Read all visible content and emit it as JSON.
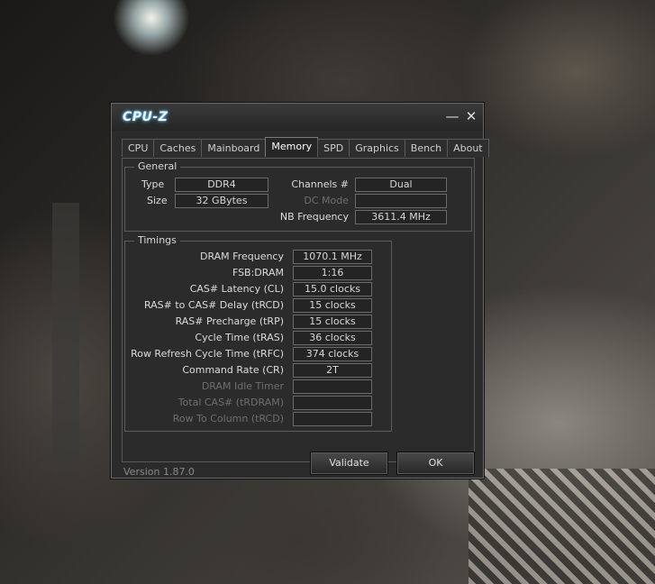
{
  "window": {
    "title": "CPU-Z",
    "minimize_glyph": "—",
    "close_glyph": "✕"
  },
  "tabs": [
    {
      "label": "CPU"
    },
    {
      "label": "Caches"
    },
    {
      "label": "Mainboard"
    },
    {
      "label": "Memory",
      "active": true
    },
    {
      "label": "SPD"
    },
    {
      "label": "Graphics"
    },
    {
      "label": "Bench"
    },
    {
      "label": "About"
    }
  ],
  "general": {
    "title": "General",
    "type_label": "Type",
    "type_value": "DDR4",
    "size_label": "Size",
    "size_value": "32 GBytes",
    "channels_label": "Channels #",
    "channels_value": "Dual",
    "dcmode_label": "DC Mode",
    "dcmode_value": "",
    "nbfreq_label": "NB Frequency",
    "nbfreq_value": "3611.4 MHz"
  },
  "timings": {
    "title": "Timings",
    "rows": [
      {
        "label": "DRAM Frequency",
        "value": "1070.1 MHz",
        "enabled": true
      },
      {
        "label": "FSB:DRAM",
        "value": "1:16",
        "enabled": true
      },
      {
        "label": "CAS# Latency (CL)",
        "value": "15.0 clocks",
        "enabled": true
      },
      {
        "label": "RAS# to CAS# Delay (tRCD)",
        "value": "15 clocks",
        "enabled": true
      },
      {
        "label": "RAS# Precharge (tRP)",
        "value": "15 clocks",
        "enabled": true
      },
      {
        "label": "Cycle Time (tRAS)",
        "value": "36 clocks",
        "enabled": true
      },
      {
        "label": "Row Refresh Cycle Time (tRFC)",
        "value": "374 clocks",
        "enabled": true
      },
      {
        "label": "Command Rate (CR)",
        "value": "2T",
        "enabled": true
      },
      {
        "label": "DRAM Idle Timer",
        "value": "",
        "enabled": false
      },
      {
        "label": "Total CAS# (tRDRAM)",
        "value": "",
        "enabled": false
      },
      {
        "label": "Row To Column (tRCD)",
        "value": "",
        "enabled": false
      }
    ]
  },
  "footer": {
    "version": "Version 1.87.0",
    "validate_label": "Validate",
    "ok_label": "OK"
  }
}
